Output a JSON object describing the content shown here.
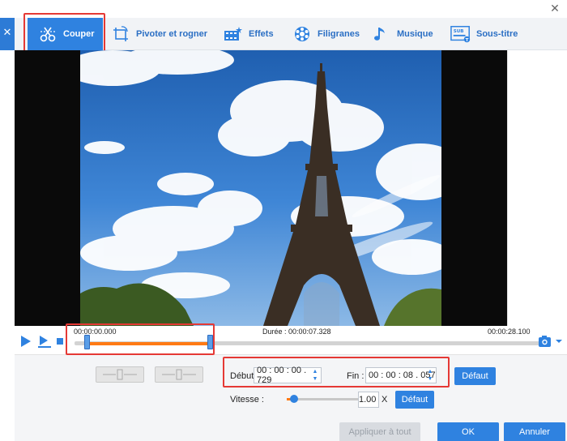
{
  "window": {
    "close_glyph": "✕"
  },
  "left_strip": {
    "close_glyph": "✕"
  },
  "tabs": [
    {
      "label": "Couper",
      "icon": "cut-icon",
      "active": true
    },
    {
      "label": "Pivoter et rogner",
      "icon": "rotate-crop-icon",
      "active": false
    },
    {
      "label": "Effets",
      "icon": "effects-icon",
      "active": false
    },
    {
      "label": "Filigranes",
      "icon": "watermark-icon",
      "active": false
    },
    {
      "label": "Musique",
      "icon": "music-icon",
      "active": false
    },
    {
      "label": "Sous-titre",
      "icon": "subtitle-icon",
      "active": false
    }
  ],
  "timeline": {
    "start": "00:00:00.000",
    "duration": "Durée : 00:00:07.328",
    "end": "00:00:28.100",
    "selection_start_fraction": 0.026,
    "selection_end_fraction": 0.286
  },
  "trim": {
    "start_label": "Début",
    "start_value": "00 : 00 : 00 . 729",
    "end_label": "Fin :",
    "end_value": "00 : 00 : 08 . 057",
    "default_label": "Défaut"
  },
  "speed": {
    "label": "Vitesse :",
    "value": "1.00",
    "unit": "X",
    "default_label": "Défaut",
    "level_fraction": 0.1
  },
  "footer": {
    "apply_all": "Appliquer à tout",
    "ok": "OK",
    "cancel": "Annuler"
  },
  "colors": {
    "accent": "#2f82e0",
    "highlight_box": "#e53935",
    "selection": "#ff7a14"
  }
}
